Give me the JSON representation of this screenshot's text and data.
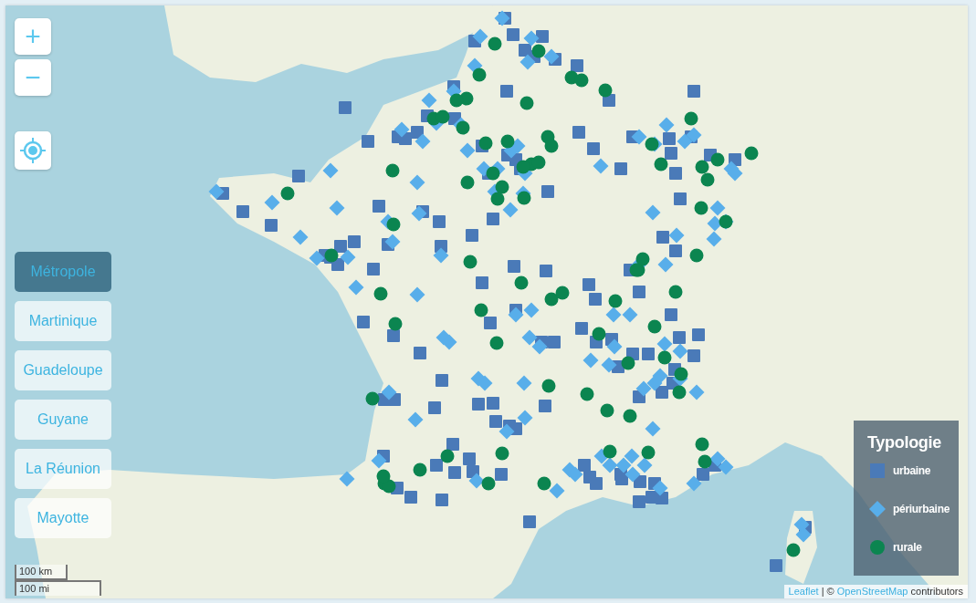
{
  "map_controls": {
    "zoom_in": "+",
    "zoom_out": "−"
  },
  "territories": [
    {
      "label": "Métropole",
      "selected": true
    },
    {
      "label": "Martinique",
      "selected": false
    },
    {
      "label": "Guadeloupe",
      "selected": false
    },
    {
      "label": "Guyane",
      "selected": false
    },
    {
      "label": "La Réunion",
      "selected": false
    },
    {
      "label": "Mayotte",
      "selected": false
    }
  ],
  "legend": {
    "title": "Typologie",
    "items": [
      {
        "kind": "square",
        "label": "urbaine",
        "color": "#4a7ab8"
      },
      {
        "kind": "diamond",
        "label": "périurbaine",
        "color": "#58aeea"
      },
      {
        "kind": "circle",
        "label": "rurale",
        "color": "#0b8550"
      }
    ]
  },
  "scale": {
    "metric": "100 km",
    "imperial": "100 mi"
  },
  "attribution": [
    {
      "kind": "link",
      "text": "Leaflet"
    },
    {
      "kind": "plain",
      "text": "| ©"
    },
    {
      "kind": "link",
      "text": "OpenStreetMap"
    },
    {
      "kind": "plain",
      "text": "contributors"
    }
  ]
}
